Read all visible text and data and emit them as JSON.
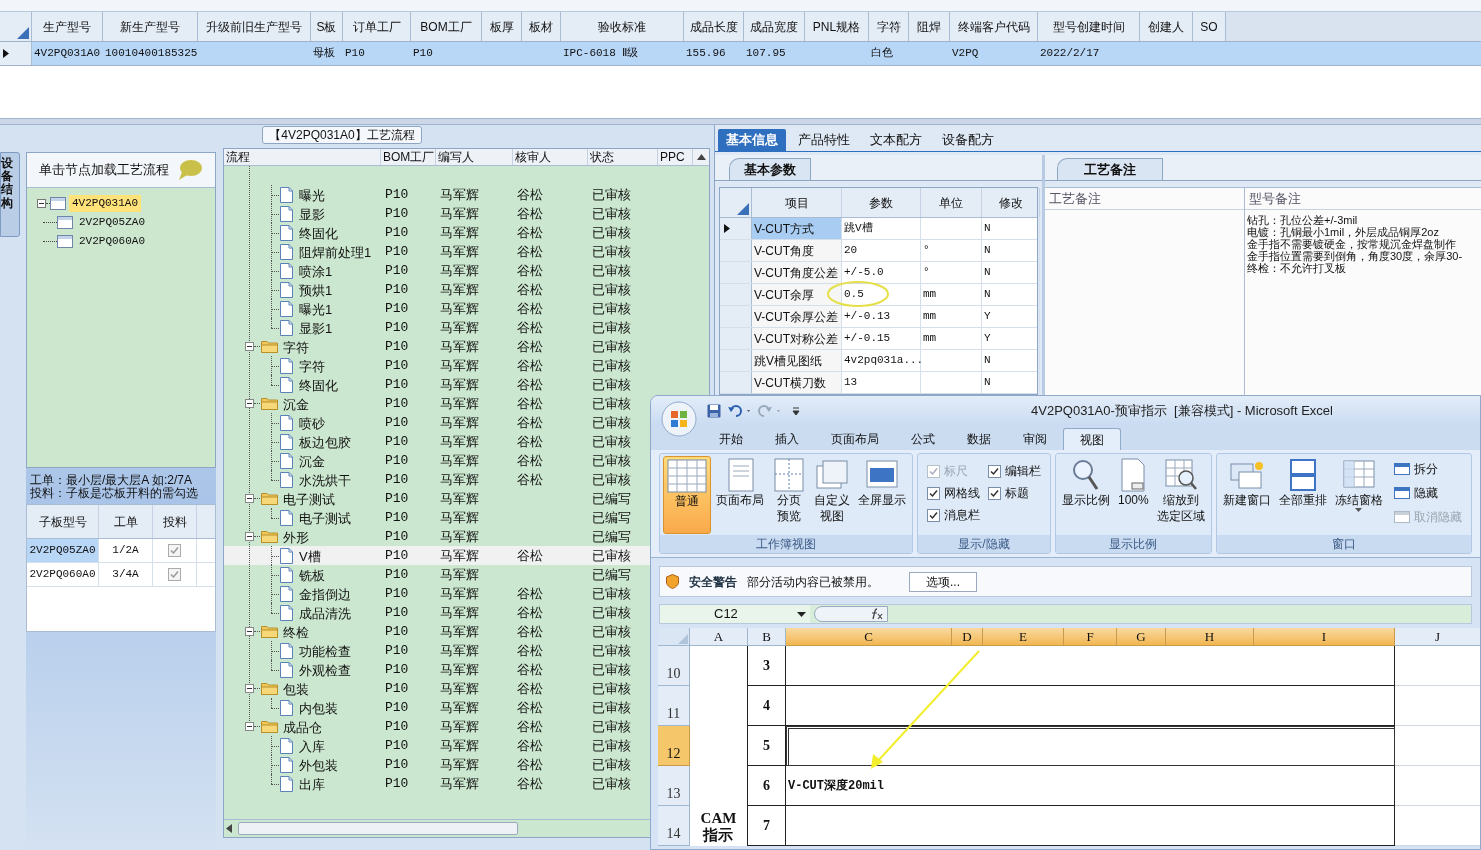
{
  "product_grid": {
    "columns": [
      "生产型号",
      "新生产型号",
      "升级前旧生产型号",
      "S板",
      "订单工厂",
      "BOM工厂",
      "板厚",
      "板材",
      "验收标准",
      "成品长度",
      "成品宽度",
      "PNL规格",
      "字符",
      "阻焊",
      "终端客户代码",
      "型号创建时间",
      "创建人",
      "SO"
    ],
    "rows": [
      {
        "selected": true,
        "cells": [
          "4V2PQ031A0",
          "10010400185325",
          null,
          "母板",
          "P10",
          "P10",
          null,
          null,
          "IPC-6018 Ⅱ级",
          "155.96",
          "107.95",
          null,
          "白色",
          null,
          "V2PQ",
          "2022/2/17",
          null,
          null
        ]
      }
    ]
  },
  "process_panel": {
    "title": "【4V2PQ031A0】工艺流程",
    "side_tab": "设备结构",
    "tree_header": "单击节点加载工艺流程",
    "tree": [
      {
        "label": "4V2PQ031A0",
        "selected": true,
        "expanded": true,
        "children": [
          {
            "label": "2V2PQ05ZA0",
            "selected": false
          },
          {
            "label": "2V2PQ060A0",
            "selected": false
          }
        ]
      }
    ],
    "notes": [
      "工单：最小层/最大层A 如:2/7A",
      "投料：子板是芯板开料的需勾选"
    ],
    "sub_boards": {
      "columns": [
        "子板型号",
        "工单",
        "投料"
      ],
      "rows": [
        {
          "cells": [
            "2V2PQ05ZA0",
            "1/2A"
          ],
          "checked": true,
          "selected": true
        },
        {
          "cells": [
            "2V2PQ060A0",
            "3/4A"
          ],
          "checked": true,
          "selected": false
        }
      ]
    },
    "flow": {
      "columns": [
        "流程",
        "BOM工厂",
        "编写人",
        "核审人",
        "状态",
        "PPC"
      ],
      "rows": [
        {
          "kind": "step",
          "label": "曝光",
          "bom": "P10",
          "writer": "马军辉",
          "reviewer": "谷松",
          "status": "已审核",
          "selected": false
        },
        {
          "kind": "step",
          "label": "显影",
          "bom": "P10",
          "writer": "马军辉",
          "reviewer": "谷松",
          "status": "已审核",
          "selected": false
        },
        {
          "kind": "step",
          "label": "终固化",
          "bom": "P10",
          "writer": "马军辉",
          "reviewer": "谷松",
          "status": "已审核",
          "selected": false
        },
        {
          "kind": "step",
          "label": "阻焊前处理1",
          "bom": "P10",
          "writer": "马军辉",
          "reviewer": "谷松",
          "status": "已审核",
          "selected": false
        },
        {
          "kind": "step",
          "label": "喷涂1",
          "bom": "P10",
          "writer": "马军辉",
          "reviewer": "谷松",
          "status": "已审核",
          "selected": false
        },
        {
          "kind": "step",
          "label": "预烘1",
          "bom": "P10",
          "writer": "马军辉",
          "reviewer": "谷松",
          "status": "已审核",
          "selected": false
        },
        {
          "kind": "step",
          "label": "曝光1",
          "bom": "P10",
          "writer": "马军辉",
          "reviewer": "谷松",
          "status": "已审核",
          "selected": false
        },
        {
          "kind": "step",
          "label": "显影1",
          "bom": "P10",
          "writer": "马军辉",
          "reviewer": "谷松",
          "status": "已审核",
          "selected": false
        },
        {
          "kind": "folder",
          "label": "字符",
          "bom": "P10",
          "writer": "马军辉",
          "reviewer": "谷松",
          "status": "已审核",
          "selected": false,
          "expanded": true,
          "children": [
            {
              "kind": "step",
              "label": "字符",
              "bom": "P10",
              "writer": "马军辉",
              "reviewer": "谷松",
              "status": "已审核",
              "selected": false
            },
            {
              "kind": "step",
              "label": "终固化",
              "bom": "P10",
              "writer": "马军辉",
              "reviewer": "谷松",
              "status": "已审核",
              "selected": false
            }
          ]
        },
        {
          "kind": "folder",
          "label": "沉金",
          "bom": "P10",
          "writer": "马军辉",
          "reviewer": "谷松",
          "status": "已审核",
          "selected": false,
          "expanded": true,
          "children": [
            {
              "kind": "step",
              "label": "喷砂",
              "bom": "P10",
              "writer": "马军辉",
              "reviewer": "谷松",
              "status": "已审核",
              "selected": false
            },
            {
              "kind": "step",
              "label": "板边包胶",
              "bom": "P10",
              "writer": "马军辉",
              "reviewer": "谷松",
              "status": "已审核",
              "selected": false
            },
            {
              "kind": "step",
              "label": "沉金",
              "bom": "P10",
              "writer": "马军辉",
              "reviewer": "谷松",
              "status": "已审核",
              "selected": false
            },
            {
              "kind": "step",
              "label": "水洗烘干",
              "bom": "P10",
              "writer": "马军辉",
              "reviewer": "谷松",
              "status": "已审核",
              "selected": false
            }
          ]
        },
        {
          "kind": "folder",
          "label": "电子测试",
          "bom": "P10",
          "writer": "马军辉",
          "status": "已编写",
          "selected": false,
          "expanded": true,
          "children": [
            {
              "kind": "step",
              "label": "电子测试",
              "bom": "P10",
              "writer": "马军辉",
              "status": "已编写",
              "selected": false
            }
          ]
        },
        {
          "kind": "folder",
          "label": "外形",
          "bom": "P10",
          "writer": "马军辉",
          "status": "已编写",
          "selected": false,
          "expanded": true,
          "children": [
            {
              "kind": "step",
              "label": "V槽",
              "bom": "P10",
              "writer": "马军辉",
              "reviewer": "谷松",
              "status": "已审核",
              "selected": true
            },
            {
              "kind": "step",
              "label": "铣板",
              "bom": "P10",
              "writer": "马军辉",
              "status": "已编写",
              "selected": false
            },
            {
              "kind": "step",
              "label": "金指倒边",
              "bom": "P10",
              "writer": "马军辉",
              "reviewer": "谷松",
              "status": "已审核",
              "selected": false
            },
            {
              "kind": "step",
              "label": "成品清洗",
              "bom": "P10",
              "writer": "马军辉",
              "reviewer": "谷松",
              "status": "已审核",
              "selected": false
            }
          ]
        },
        {
          "kind": "folder",
          "label": "终检",
          "bom": "P10",
          "writer": "马军辉",
          "reviewer": "谷松",
          "status": "已审核",
          "selected": false,
          "expanded": true,
          "children": [
            {
              "kind": "step",
              "label": "功能检查",
              "bom": "P10",
              "writer": "马军辉",
              "reviewer": "谷松",
              "status": "已审核",
              "selected": false
            },
            {
              "kind": "step",
              "label": "外观检查",
              "bom": "P10",
              "writer": "马军辉",
              "reviewer": "谷松",
              "status": "已审核",
              "selected": false
            }
          ]
        },
        {
          "kind": "folder",
          "label": "包装",
          "bom": "P10",
          "writer": "马军辉",
          "reviewer": "谷松",
          "status": "已审核",
          "selected": false,
          "expanded": true,
          "children": [
            {
              "kind": "step",
              "label": "内包装",
              "bom": "P10",
              "writer": "马军辉",
              "reviewer": "谷松",
              "status": "已审核",
              "selected": false
            }
          ]
        },
        {
          "kind": "folder",
          "label": "成品仓",
          "bom": "P10",
          "writer": "马军辉",
          "reviewer": "谷松",
          "status": "已审核",
          "selected": false,
          "expanded": true,
          "children": [
            {
              "kind": "step",
              "label": "入库",
              "bom": "P10",
              "writer": "马军辉",
              "reviewer": "谷松",
              "status": "已审核",
              "selected": false
            },
            {
              "kind": "step",
              "label": "外包装",
              "bom": "P10",
              "writer": "马军辉",
              "reviewer": "谷松",
              "status": "已审核",
              "selected": false
            },
            {
              "kind": "step",
              "label": "出库",
              "bom": "P10",
              "writer": "马军辉",
              "reviewer": "谷松",
              "status": "已审核",
              "selected": false
            }
          ]
        }
      ]
    }
  },
  "detail_panel": {
    "tabs": [
      {
        "label": "基本信息",
        "selected": true
      },
      {
        "label": "产品特性",
        "selected": false
      },
      {
        "label": "文本配方",
        "selected": false
      },
      {
        "label": "设备配方",
        "selected": false
      }
    ],
    "params_tab": "基本参数",
    "params": {
      "columns": [
        "项目",
        "参数",
        "单位",
        "修改"
      ],
      "rows": [
        {
          "item": "V-CUT方式",
          "value": "跳V槽",
          "modify": "N",
          "selected": true,
          "circled": false
        },
        {
          "item": "V-CUT角度",
          "value": "20",
          "unit": "°",
          "modify": "N",
          "selected": false,
          "circled": false
        },
        {
          "item": "V-CUT角度公差",
          "value": "+/-5.0",
          "unit": "°",
          "modify": "N",
          "selected": false,
          "circled": false
        },
        {
          "item": "V-CUT余厚",
          "value": "0.5",
          "unit": "mm",
          "modify": "N",
          "selected": false,
          "circled": true
        },
        {
          "item": "V-CUT余厚公差",
          "value": "+/-0.13",
          "unit": "mm",
          "modify": "Y",
          "selected": false,
          "circled": false
        },
        {
          "item": "V-CUT对称公差",
          "value": "+/-0.15",
          "unit": "mm",
          "modify": "Y",
          "selected": false,
          "circled": false
        },
        {
          "item": "跳V槽见图纸",
          "value": "4v2pq031a...",
          "modify": "N",
          "selected": false,
          "circled": false
        },
        {
          "item": "V-CUT横刀数",
          "value": "13",
          "modify": "N",
          "selected": false,
          "circled": false
        }
      ]
    },
    "notes_tab": "工艺备注",
    "notes_columns": [
      "工艺备注",
      "型号备注"
    ],
    "model_notes": [
      "钻孔：孔位公差+/-3mil",
      "电镀：孔铜最小1mil，外层成品铜厚2oz",
      "金手指不需要镀硬金，按常规沉金焊盘制作",
      "金手指位置需要到倒角，角度30度，余厚30-",
      "终检：不允许打叉板"
    ]
  },
  "excel": {
    "title": "4V2PQ031A0-预审指示  [兼容模式] - Microsoft Excel",
    "tabs": [
      {
        "label": "开始",
        "selected": false
      },
      {
        "label": "插入",
        "selected": false
      },
      {
        "label": "页面布局",
        "selected": false
      },
      {
        "label": "公式",
        "selected": false
      },
      {
        "label": "数据",
        "selected": false
      },
      {
        "label": "审阅",
        "selected": false
      },
      {
        "label": "视图",
        "selected": true
      }
    ],
    "ribbon_groups": [
      {
        "label": "工作簿视图",
        "items": [
          {
            "kind": "large",
            "lines": [
              "普通"
            ],
            "selected": true
          },
          {
            "kind": "large",
            "lines": [
              "页面布局"
            ],
            "selected": false
          },
          {
            "kind": "large",
            "lines": [
              "分页",
              "预览"
            ],
            "selected": false
          },
          {
            "kind": "large",
            "lines": [
              "自定义",
              "视图"
            ],
            "selected": false
          },
          {
            "kind": "large",
            "lines": [
              "全屏显示"
            ],
            "selected": false
          }
        ]
      },
      {
        "label": "显示/隐藏",
        "items": [
          {
            "kind": "check",
            "label": "标尺",
            "checked": true,
            "disabled": true
          },
          {
            "kind": "check",
            "label": "编辑栏",
            "checked": true,
            "disabled": false
          },
          {
            "kind": "check",
            "label": "网格线",
            "checked": true,
            "disabled": false
          },
          {
            "kind": "check",
            "label": "标题",
            "checked": true,
            "disabled": false
          },
          {
            "kind": "check",
            "label": "消息栏",
            "checked": true,
            "disabled": false
          }
        ]
      },
      {
        "label": "显示比例",
        "items": [
          {
            "kind": "large",
            "lines": [
              "显示比例"
            ]
          },
          {
            "kind": "large",
            "lines": [
              "100%"
            ]
          },
          {
            "kind": "large",
            "lines": [
              "缩放到",
              "选定区域"
            ]
          }
        ]
      },
      {
        "label": "窗口",
        "items": [
          {
            "kind": "large",
            "lines": [
              "新建窗口"
            ]
          },
          {
            "kind": "large",
            "lines": [
              "全部重排"
            ]
          },
          {
            "kind": "large",
            "lines": [
              "冻结窗格"
            ],
            "dropdown": true
          },
          {
            "kind": "small",
            "label": "拆分",
            "disabled": false
          },
          {
            "kind": "small",
            "label": "隐藏",
            "disabled": false
          },
          {
            "kind": "small",
            "label": "取消隐藏",
            "disabled": true
          }
        ]
      }
    ],
    "security": {
      "title": "安全警告",
      "message": "部分活动内容已被禁用。",
      "button": "选项..."
    },
    "name_box": "C12",
    "grid": {
      "columns": [
        {
          "label": "A",
          "selected": false
        },
        {
          "label": "B",
          "selected": false
        },
        {
          "label": "C",
          "selected": true
        },
        {
          "label": "D",
          "selected": true
        },
        {
          "label": "E",
          "selected": true
        },
        {
          "label": "F",
          "selected": true
        },
        {
          "label": "G",
          "selected": true
        },
        {
          "label": "H",
          "selected": true
        },
        {
          "label": "I",
          "selected": true
        },
        {
          "label": "J",
          "selected": false
        }
      ],
      "a_text": "CAM\n指示",
      "rows": [
        {
          "number": "10",
          "selected": false,
          "b": "3"
        },
        {
          "number": "11",
          "selected": false,
          "b": "4"
        },
        {
          "number": "12",
          "selected": true,
          "b": "5"
        },
        {
          "number": "13",
          "selected": false,
          "b": "6",
          "c": "V-CUT深度20mil"
        },
        {
          "number": "14",
          "selected": false,
          "b": "7"
        }
      ]
    }
  }
}
